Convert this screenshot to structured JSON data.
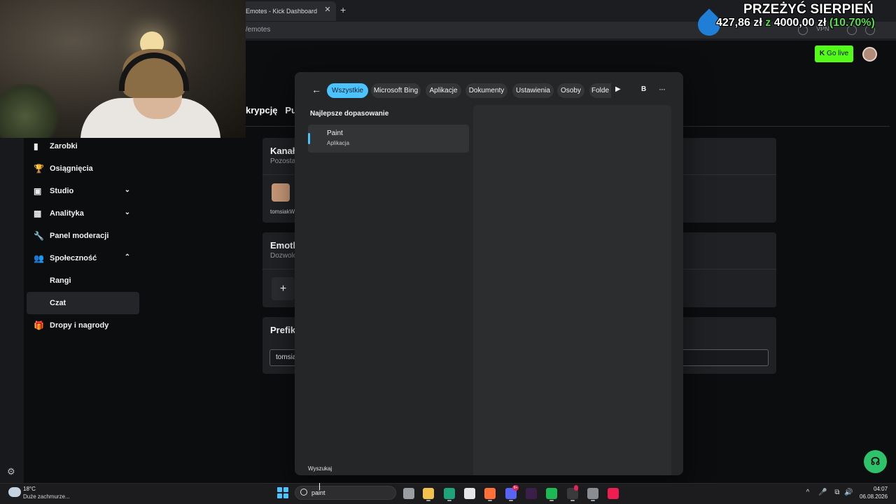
{
  "browser": {
    "tab_title": "Emotes - Kick Dashboard",
    "tab_close": "✕",
    "new_tab": "+",
    "url": "t/emotes",
    "vpn_label": "VPN"
  },
  "overlay": {
    "title": "PRZEŻYĆ SIERPIEŃ",
    "current": "427,86 zł",
    "of": "z",
    "goal": "4000,00 zł",
    "percent": "(10.70%)",
    "progress_fraction": 0.107
  },
  "header": {
    "go_live": "Go live",
    "go_live_icon": "K"
  },
  "nav": {
    "items": [
      {
        "icon": "▮",
        "label": "Zarobki"
      },
      {
        "icon": "🏆",
        "label": "Osiągnięcia"
      },
      {
        "icon": "▣",
        "label": "Studio",
        "chevron": "⌄"
      },
      {
        "icon": "▦",
        "label": "Analityka",
        "chevron": "⌄"
      },
      {
        "icon": "🔧",
        "label": "Panel moderacji"
      },
      {
        "icon": "👥",
        "label": "Społeczność",
        "chevron": "⌃"
      },
      {
        "label": "Rangi"
      },
      {
        "label": "Czat"
      },
      {
        "icon": "🎁",
        "label": "Dropy i nagrody"
      }
    ]
  },
  "main": {
    "tabs_text": "krypcję   Pun",
    "card1": {
      "title": "Kanał",
      "sub": "Pozosta",
      "emote_name": "tomsiakW"
    },
    "card2": {
      "title": "Emotk",
      "sub": "Dozwolo",
      "add": "+"
    },
    "card3": {
      "title": "Prefik",
      "input_value": "tomsia"
    }
  },
  "search": {
    "back": "←",
    "filters": [
      "Wszystkie",
      "Microsoft Bing",
      "Aplikacje",
      "Dokumenty",
      "Ustawienia",
      "Osoby",
      "Folde"
    ],
    "play": "▶",
    "avatar_letter": "B",
    "more": "···",
    "best_match_header": "Najlepsze dopasowanie",
    "result_name": "Paint",
    "result_type": "Aplikacja",
    "footer": "Wyszukaj"
  },
  "taskbar": {
    "weather_temp": "18°C",
    "weather_desc": "Duże zachmurze...",
    "search_text": "paint",
    "badge1": "9+",
    "badge2": "",
    "clock_time": "04:07",
    "clock_date": "06.08.2026",
    "tray_icons": [
      "^",
      "🎤",
      "⧉",
      "🔊"
    ],
    "apps": [
      {
        "name": "task-view-icon",
        "color": "#9a9da2"
      },
      {
        "name": "file-explorer-icon",
        "color": "#f2c14e"
      },
      {
        "name": "edge-icon",
        "color": "#1fa37a"
      },
      {
        "name": "store-icon",
        "color": "#e6e6e6"
      },
      {
        "name": "firefox-icon",
        "color": "#ff7139"
      },
      {
        "name": "discord-icon",
        "color": "#5865f2"
      },
      {
        "name": "next-icon",
        "color": "#3b1f4a"
      },
      {
        "name": "spotify-icon",
        "color": "#1db954"
      },
      {
        "name": "obs-icon",
        "color": "#3a3a3a"
      },
      {
        "name": "settings-icon",
        "color": "#8a8d91"
      },
      {
        "name": "tiktok-icon",
        "color": "#ee1d52"
      }
    ]
  },
  "sidebar": {
    "settings_icon": "⚙"
  },
  "help_icon": "☊"
}
